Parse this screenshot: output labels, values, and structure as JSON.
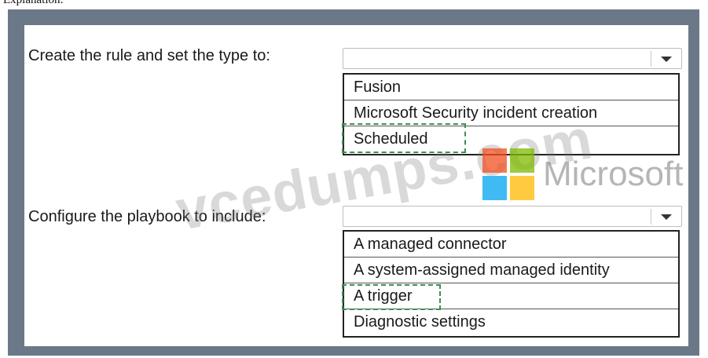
{
  "page_heading": "Explanation:",
  "question1": {
    "label": "Create the rule and set the type to:",
    "selected": "",
    "options": [
      "Fusion",
      "Microsoft Security incident creation",
      "Scheduled"
    ],
    "answer_index": 2
  },
  "question2": {
    "label": "Configure the playbook to include:",
    "selected": "",
    "options": [
      "A managed connector",
      "A system-assigned managed identity",
      "A trigger",
      "Diagnostic settings"
    ],
    "answer_index": 2
  },
  "watermark": {
    "site_text": "vcedumps.com",
    "brand_text": "Microsoft",
    "logo_colors": [
      "#f25022",
      "#7fba00",
      "#00a4ef",
      "#ffb900"
    ]
  },
  "colors": {
    "frame": "#6b7888",
    "answer_highlight": "#3d8f55"
  }
}
